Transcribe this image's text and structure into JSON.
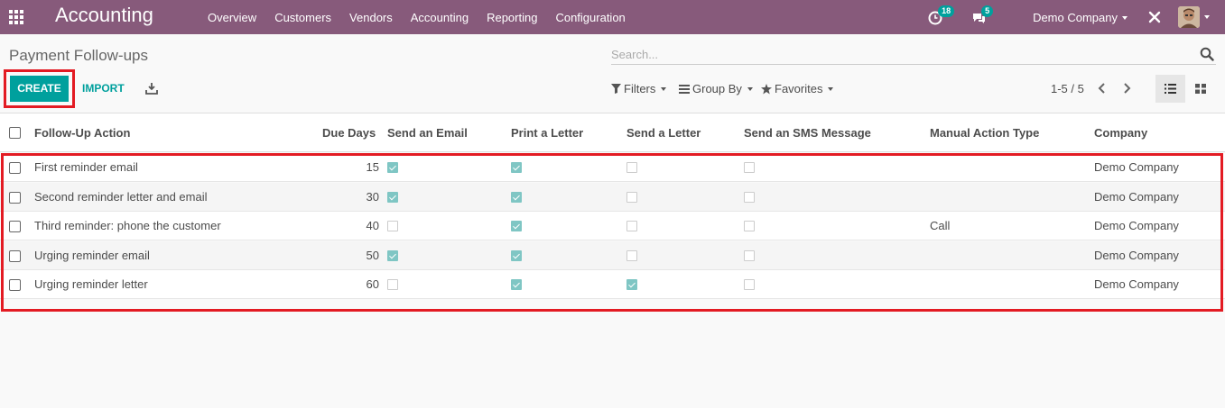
{
  "navbar": {
    "app_name": "Accounting",
    "menu": [
      "Overview",
      "Customers",
      "Vendors",
      "Accounting",
      "Reporting",
      "Configuration"
    ],
    "activity_count": "18",
    "message_count": "5",
    "company": "Demo Company",
    "bg_color": "#875a7b"
  },
  "control_panel": {
    "title": "Payment Follow-ups",
    "search_placeholder": "Search...",
    "create_label": "CREATE",
    "import_label": "IMPORT",
    "filters_label": "Filters",
    "groupby_label": "Group By",
    "favorites_label": "Favorites",
    "pager": "1-5 / 5",
    "accent_color": "#00a09d"
  },
  "table": {
    "columns": [
      "Follow-Up Action",
      "Due Days",
      "Send an Email",
      "Print a Letter",
      "Send a Letter",
      "Send an SMS Message",
      "Manual Action Type",
      "Company"
    ],
    "rows": [
      {
        "name": "First reminder email",
        "due_days": "15",
        "send_email": true,
        "print_letter": true,
        "send_letter": false,
        "send_sms": false,
        "manual_action": "",
        "company": "Demo Company"
      },
      {
        "name": "Second reminder letter and email",
        "due_days": "30",
        "send_email": true,
        "print_letter": true,
        "send_letter": false,
        "send_sms": false,
        "manual_action": "",
        "company": "Demo Company"
      },
      {
        "name": "Third reminder: phone the customer",
        "due_days": "40",
        "send_email": false,
        "print_letter": true,
        "send_letter": false,
        "send_sms": false,
        "manual_action": "Call",
        "company": "Demo Company"
      },
      {
        "name": "Urging reminder email",
        "due_days": "50",
        "send_email": true,
        "print_letter": true,
        "send_letter": false,
        "send_sms": false,
        "manual_action": "",
        "company": "Demo Company"
      },
      {
        "name": "Urging reminder letter",
        "due_days": "60",
        "send_email": false,
        "print_letter": true,
        "send_letter": true,
        "send_sms": false,
        "manual_action": "",
        "company": "Demo Company"
      }
    ]
  },
  "annotation_color": "#e31b23"
}
